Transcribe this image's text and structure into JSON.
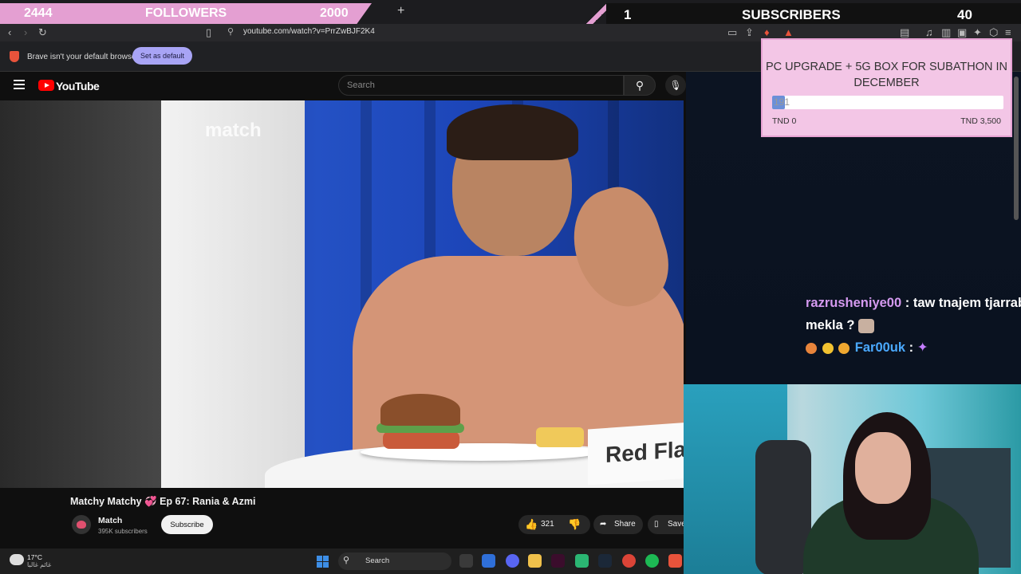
{
  "overlay": {
    "followers_count": "2444",
    "followers_label": "FOLLOWERS",
    "followers_goal": "2000",
    "subs_count": "1",
    "subs_label": "SUBSCRIBERS",
    "subs_goal": "40"
  },
  "browser": {
    "new_tab": "+",
    "url": "youtube.com/watch?v=PrrZwBJF2K4",
    "default_message": "Brave isn't your default browser",
    "set_default_label": "Set as default"
  },
  "youtube": {
    "logo_text": "YouTube",
    "search_placeholder": "Search",
    "video_watermark": "match",
    "video_card_text": "Red Fla",
    "title": "Matchy Matchy 💞 Ep 67: Rania & Azmi",
    "channel": "Match",
    "subscribers": "395K subscribers",
    "subscribe_label": "Subscribe",
    "likes": "321",
    "share_label": "Share",
    "save_label": "Save"
  },
  "goal": {
    "title": "PC UPGRADE + 5G BOX FOR SUBATHON IN DECEMBER",
    "current": "191",
    "min_label": "TND 0",
    "max_label": "TND 3,500",
    "progress": 0.055
  },
  "chat": [
    {
      "user": "razrusheniye00",
      "message": ": taw tnajem tjarrab",
      "message2": "mekla ?"
    },
    {
      "user": "Far00uk",
      "message": ":"
    }
  ],
  "taskbar": {
    "temperature": "17°C",
    "weather_sub": "غائم غالبا",
    "search_label": "Search"
  },
  "colors": {
    "overlay_pink": "#e49fd2",
    "goal_bg": "#f3c6e6",
    "youtube_red": "#ff0000"
  }
}
